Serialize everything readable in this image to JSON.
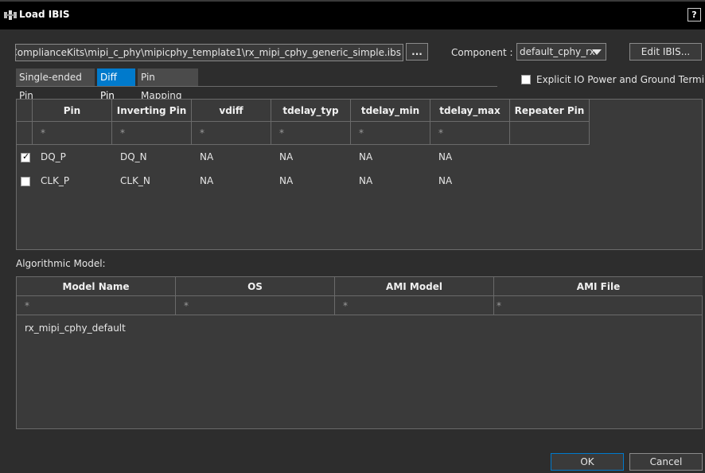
{
  "window": {
    "title": "Load IBIS",
    "help_label": "?"
  },
  "file": {
    "path": ".topxp\\ComplianceKits\\mipi_c_phy\\mipicphy_template1\\rx_mipi_cphy_generic_simple.ibs",
    "browse_label": "..."
  },
  "component": {
    "label": "Component :",
    "value": "default_cphy_rx"
  },
  "edit_ibis_label": "Edit IBIS...",
  "tabs": [
    {
      "label": "Single-ended Pin",
      "active": false
    },
    {
      "label": "Diff Pin",
      "active": true
    },
    {
      "label": "Pin Mapping",
      "active": false
    }
  ],
  "explicit_io": {
    "label": "Explicit IO Power and Ground Terminals",
    "checked": false
  },
  "pin_table": {
    "columns": [
      "Pin",
      "Inverting Pin",
      "vdiff",
      "tdelay_typ",
      "tdelay_min",
      "tdelay_max",
      "Repeater Pin"
    ],
    "filters": [
      "*",
      "*",
      "*",
      "*",
      "*",
      "*",
      ""
    ],
    "rows": [
      {
        "checked": true,
        "cells": [
          "DQ_P",
          "DQ_N",
          "NA",
          "NA",
          "NA",
          "NA",
          ""
        ]
      },
      {
        "checked": false,
        "cells": [
          "CLK_P",
          "CLK_N",
          "NA",
          "NA",
          "NA",
          "NA",
          ""
        ]
      }
    ]
  },
  "algorithmic": {
    "label": "Algorithmic Model:",
    "columns": [
      "Model Name",
      "OS",
      "AMI Model",
      "AMI File"
    ],
    "filters": [
      "*",
      "*",
      "*",
      "*"
    ],
    "rows": [
      [
        "rx_mipi_cphy_default",
        "",
        "",
        ""
      ]
    ]
  },
  "buttons": {
    "ok": "OK",
    "cancel": "Cancel"
  },
  "colors": {
    "accent": "#007acc",
    "background": "#2d2d2d",
    "titlebar": "#000000"
  }
}
